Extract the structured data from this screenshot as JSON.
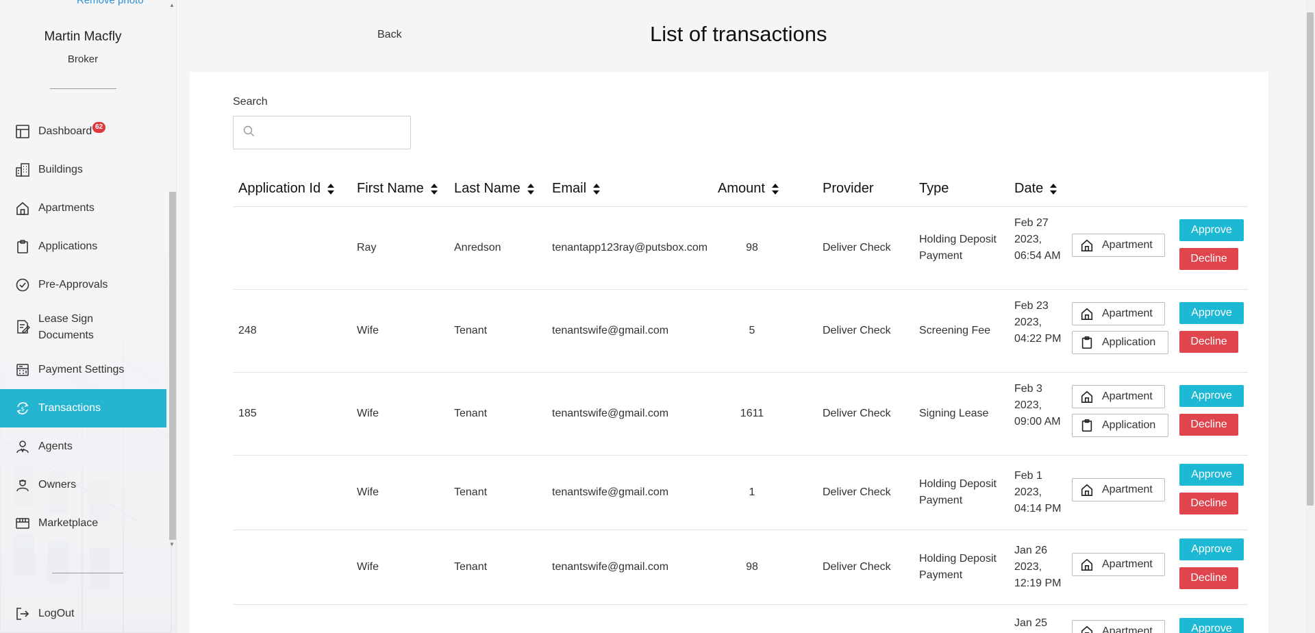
{
  "sidebar": {
    "remove_photo": "Remove photo",
    "profile": {
      "name": "Martin Macfly",
      "role": "Broker"
    },
    "items": [
      {
        "label": "Dashboard",
        "icon": "dashboard-icon",
        "badge": "62"
      },
      {
        "label": "Buildings",
        "icon": "buildings-icon"
      },
      {
        "label": "Apartments",
        "icon": "home-icon"
      },
      {
        "label": "Applications",
        "icon": "clipboard-icon"
      },
      {
        "label": "Pre-Approvals",
        "icon": "check-circle-icon"
      },
      {
        "label": "Lease Sign Documents",
        "icon": "document-sign-icon"
      },
      {
        "label": "Payment Settings",
        "icon": "calculator-icon"
      },
      {
        "label": "Transactions",
        "icon": "transactions-icon",
        "active": true
      },
      {
        "label": "Agents",
        "icon": "agent-icon"
      },
      {
        "label": "Owners",
        "icon": "owner-icon"
      },
      {
        "label": "Marketplace",
        "icon": "marketplace-icon"
      }
    ],
    "logout": "LogOut"
  },
  "header": {
    "back": "Back",
    "title": "List of transactions"
  },
  "search": {
    "label": "Search",
    "placeholder": ""
  },
  "table": {
    "columns": [
      {
        "label": "Application Id",
        "sortable": true
      },
      {
        "label": "First Name",
        "sortable": true
      },
      {
        "label": "Last Name",
        "sortable": true
      },
      {
        "label": "Email",
        "sortable": true
      },
      {
        "label": "Amount",
        "sortable": true
      },
      {
        "label": "Provider",
        "sortable": false
      },
      {
        "label": "Type",
        "sortable": false
      },
      {
        "label": "Date",
        "sortable": true
      }
    ],
    "rows": [
      {
        "id": "",
        "first": "Ray",
        "last": "Anredson",
        "email": "tenantapp123ray@putsbox.com",
        "amount": "98",
        "provider": "Deliver Check",
        "type": "Holding Deposit Payment",
        "date": "Feb 27 2023, 06:54 AM",
        "links": [
          "Apartment"
        ]
      },
      {
        "id": "248",
        "first": "Wife",
        "last": "Tenant",
        "email": "tenantswife@gmail.com",
        "amount": "5",
        "provider": "Deliver Check",
        "type": "Screening Fee",
        "date": "Feb 23 2023, 04:22 PM",
        "links": [
          "Apartment",
          "Application"
        ]
      },
      {
        "id": "185",
        "first": "Wife",
        "last": "Tenant",
        "email": "tenantswife@gmail.com",
        "amount": "1611",
        "provider": "Deliver Check",
        "type": "Signing Lease",
        "date": "Feb 3 2023, 09:00 AM",
        "links": [
          "Apartment",
          "Application"
        ]
      },
      {
        "id": "",
        "first": "Wife",
        "last": "Tenant",
        "email": "tenantswife@gmail.com",
        "amount": "1",
        "provider": "Deliver Check",
        "type": "Holding Deposit Payment",
        "date": "Feb 1 2023, 04:14 PM",
        "links": [
          "Apartment"
        ]
      },
      {
        "id": "",
        "first": "Wife",
        "last": "Tenant",
        "email": "tenantswife@gmail.com",
        "amount": "98",
        "provider": "Deliver Check",
        "type": "Holding Deposit Payment",
        "date": "Jan 26 2023, 12:19 PM",
        "links": [
          "Apartment"
        ]
      },
      {
        "id": "",
        "first": "",
        "last": "",
        "email": "",
        "amount": "",
        "provider": "",
        "type": "",
        "date": "Jan 25",
        "links": [
          "Apartment"
        ]
      }
    ],
    "approve_label": "Approve",
    "decline_label": "Decline"
  }
}
